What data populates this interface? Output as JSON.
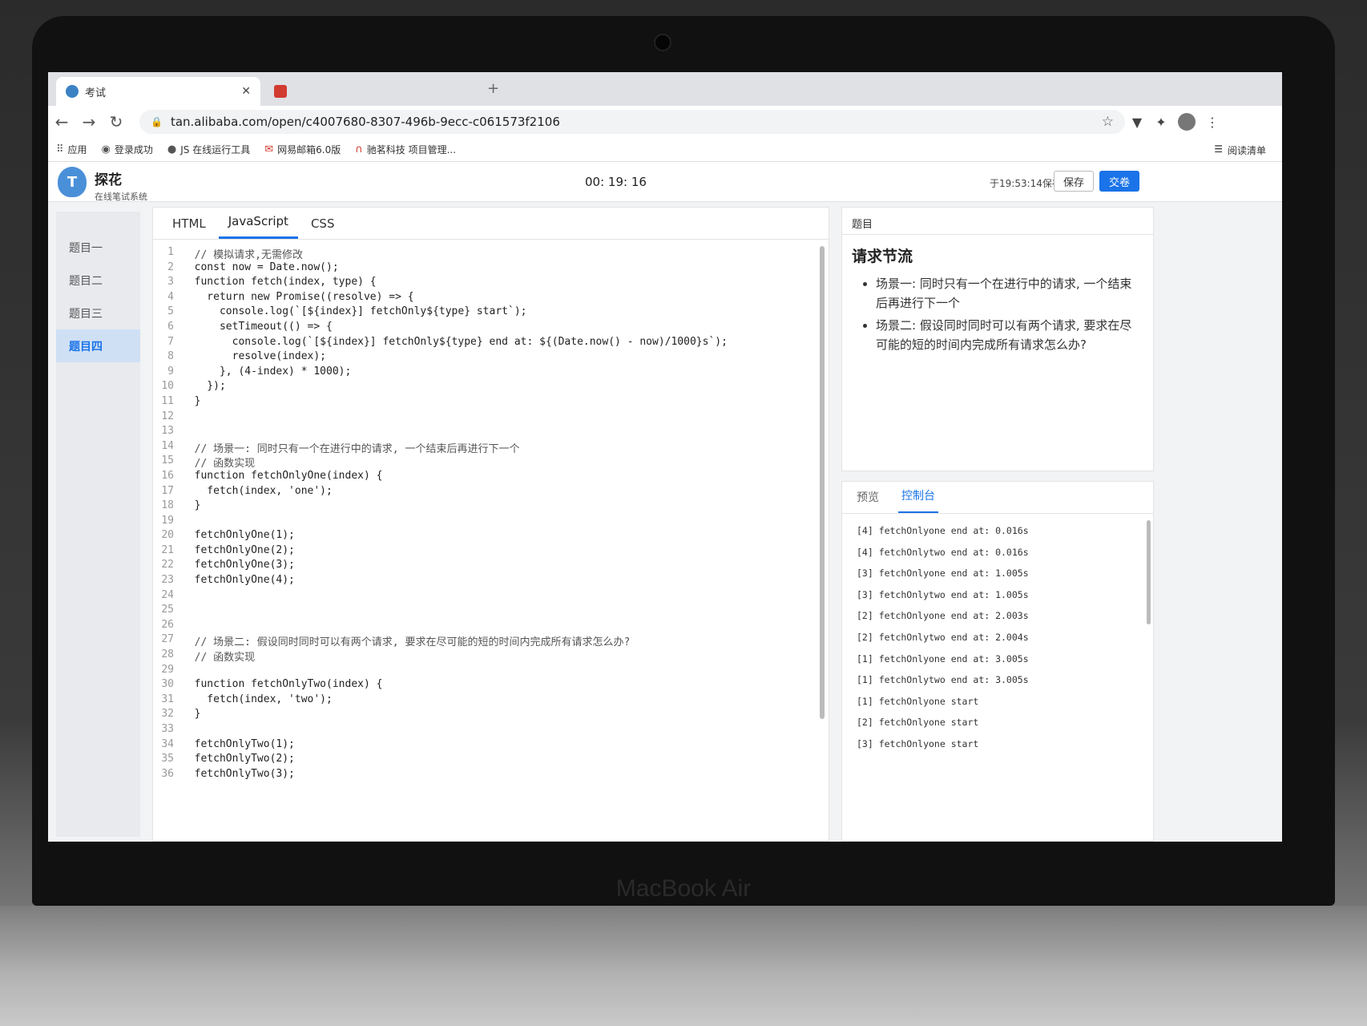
{
  "browser": {
    "tabs": [
      {
        "label": "考试",
        "active": true
      },
      {
        "label": "",
        "active": false
      }
    ],
    "new_tab": "+",
    "url": "tan.alibaba.com/open/c4007680-8307-496b-9ecc-c061573f2106",
    "bookmarks": [
      "应用",
      "登录成功",
      "JS 在线运行工具",
      "网易邮箱6.0版",
      "驰茗科技 项目管理..."
    ],
    "reading_list": "阅读清单"
  },
  "app": {
    "brand_name": "探花",
    "brand_sub": "在线笔试系统",
    "timer": "00: 19: 16",
    "saved_at": "于19:53:14保存",
    "save_label": "保存",
    "submit_label": "交卷"
  },
  "question_nav": [
    "题目一",
    "题目二",
    "题目三",
    "题目四"
  ],
  "active_question": 3,
  "editor": {
    "tabs": [
      "HTML",
      "JavaScript",
      "CSS"
    ],
    "active_tab": 1,
    "lines": [
      {
        "n": "1",
        "text": "  // 模拟请求,无需修改",
        "kind": "comment"
      },
      {
        "n": "2",
        "text": "  const now = Date.now();",
        "kind": "code"
      },
      {
        "n": "3",
        "text": "  function fetch(index, type) {",
        "kind": "code"
      },
      {
        "n": "4",
        "text": "    return new Promise((resolve) => {",
        "kind": "code"
      },
      {
        "n": "5",
        "text": "      console.log(`[${index}] fetchOnly${type} start`);",
        "kind": "code"
      },
      {
        "n": "6",
        "text": "      setTimeout(() => {",
        "kind": "code"
      },
      {
        "n": "7",
        "text": "        console.log(`[${index}] fetchOnly${type} end at: ${(Date.now() - now)/1000}s`);",
        "kind": "code"
      },
      {
        "n": "8",
        "text": "        resolve(index);",
        "kind": "code"
      },
      {
        "n": "9",
        "text": "      }, (4-index) * 1000);",
        "kind": "code"
      },
      {
        "n": "10",
        "text": "    });",
        "kind": "code"
      },
      {
        "n": "11",
        "text": "  }",
        "kind": "code"
      },
      {
        "n": "12",
        "text": "",
        "kind": "code"
      },
      {
        "n": "13",
        "text": "",
        "kind": "code"
      },
      {
        "n": "14",
        "text": "  // 场景一: 同时只有一个在进行中的请求, 一个结束后再进行下一个",
        "kind": "comment"
      },
      {
        "n": "15",
        "text": "  // 函数实现",
        "kind": "comment"
      },
      {
        "n": "16",
        "text": "  function fetchOnlyOne(index) {",
        "kind": "code"
      },
      {
        "n": "17",
        "text": "    fetch(index, 'one');",
        "kind": "code"
      },
      {
        "n": "18",
        "text": "  }",
        "kind": "code"
      },
      {
        "n": "19",
        "text": "",
        "kind": "code"
      },
      {
        "n": "20",
        "text": "  fetchOnlyOne(1);",
        "kind": "code"
      },
      {
        "n": "21",
        "text": "  fetchOnlyOne(2);",
        "kind": "code"
      },
      {
        "n": "22",
        "text": "  fetchOnlyOne(3);",
        "kind": "code"
      },
      {
        "n": "23",
        "text": "  fetchOnlyOne(4);",
        "kind": "code"
      },
      {
        "n": "24",
        "text": "",
        "kind": "code"
      },
      {
        "n": "25",
        "text": "",
        "kind": "code"
      },
      {
        "n": "26",
        "text": "",
        "kind": "code"
      },
      {
        "n": "27",
        "text": "  // 场景二: 假设同时同时可以有两个请求, 要求在尽可能的短的时间内完成所有请求怎么办?",
        "kind": "comment"
      },
      {
        "n": "28",
        "text": "  // 函数实现",
        "kind": "comment"
      },
      {
        "n": "29",
        "text": "",
        "kind": "code"
      },
      {
        "n": "30",
        "text": "  function fetchOnlyTwo(index) {",
        "kind": "code"
      },
      {
        "n": "31",
        "text": "    fetch(index, 'two');",
        "kind": "code"
      },
      {
        "n": "32",
        "text": "  }",
        "kind": "code"
      },
      {
        "n": "33",
        "text": "",
        "kind": "code"
      },
      {
        "n": "34",
        "text": "  fetchOnlyTwo(1);",
        "kind": "code"
      },
      {
        "n": "35",
        "text": "  fetchOnlyTwo(2);",
        "kind": "code"
      },
      {
        "n": "36",
        "text": "  fetchOnlyTwo(3);",
        "kind": "code"
      }
    ]
  },
  "question": {
    "panel_label": "题目",
    "title": "请求节流",
    "bullets": [
      "场景一: 同时只有一个在进行中的请求, 一个结束后再进行下一个",
      "场景二: 假设同时同时可以有两个请求, 要求在尽可能的短的时间内完成所有请求怎么办?"
    ]
  },
  "console": {
    "tabs": [
      "预览",
      "控制台"
    ],
    "active_tab": 1,
    "logs": [
      "[4] fetchOnlyone end at: 0.016s",
      "[4] fetchOnlytwo end at: 0.016s",
      "[3] fetchOnlyone end at: 1.005s",
      "[3] fetchOnlytwo end at: 1.005s",
      "[2] fetchOnlyone end at: 2.003s",
      "[2] fetchOnlytwo end at: 2.004s",
      "[1] fetchOnlyone end at: 3.005s",
      "[1] fetchOnlytwo end at: 3.005s",
      "[1] fetchOnlyone start",
      "[2] fetchOnlyone start",
      "[3] fetchOnlyone start"
    ]
  },
  "device_label": "MacBook Air",
  "colors": {
    "accent": "#1a73e8",
    "string": "#c0392b"
  }
}
